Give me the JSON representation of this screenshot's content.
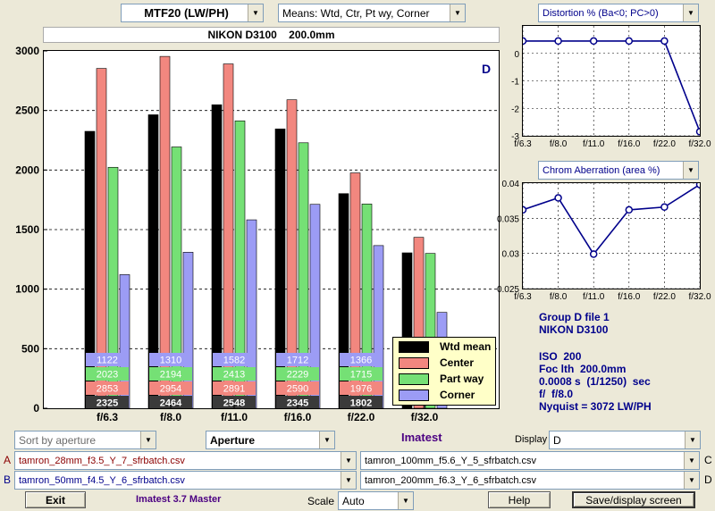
{
  "top": {
    "mtf_select": "MTF20 (LW/PH)",
    "means_select": "Means: Wtd, Ctr, Pt wy, Corner",
    "camera_title": "NIKON D3100    200.0mm"
  },
  "main_chart": {
    "group_label": "D",
    "legend": [
      "Wtd mean",
      "Center",
      "Part way",
      "Corner"
    ],
    "colors": {
      "wtd": "#000000",
      "center": "#f2877f",
      "part": "#75e075",
      "corner": "#9c9cf5"
    }
  },
  "distortion": {
    "select_label": "Distortion %  (Ba<0; PC>0)"
  },
  "chrom": {
    "select_label": "Chrom Aberration (area %)"
  },
  "info": {
    "line1": "Group D file 1",
    "line2": "NIKON D3100",
    "line3": "ISO  200",
    "line4": "Foc lth  200.0mm",
    "line5": "0.0008 s  (1/1250)  sec",
    "line6": "f/  f/8.0",
    "line7": "Nyquist = 3072 LW/PH"
  },
  "controls": {
    "sort_select": "Sort by aperture",
    "aperture_select": "Aperture",
    "imatest_label": "Imatest",
    "display_label": "Display",
    "display_select": "D",
    "file_a_tag": "A",
    "file_a": "tamron_28mm_f3.5_Y_7_sfrbatch.csv",
    "file_b_tag": "B",
    "file_b": "tamron_50mm_f4.5_Y_6_sfrbatch.csv",
    "file_c_tag": "C",
    "file_c": "tamron_100mm_f5.6_Y_5_sfrbatch.csv",
    "file_d_tag": "D",
    "file_d": "tamron_200mm_f6.3_Y_6_sfrbatch.csv",
    "exit_label": "Exit",
    "version_label": "Imatest 3.7 Master",
    "scale_label": "Scale",
    "scale_select": "Auto",
    "help_label": "Help",
    "save_label": "Save/display screen"
  },
  "icons": {
    "dropdown": "chevron-down-icon"
  },
  "chart_data": [
    {
      "type": "bar",
      "title": "",
      "xlabel": "",
      "ylabel": "",
      "categories": [
        "f/6.3",
        "f/8.0",
        "f/11.0",
        "f/16.0",
        "f/22.0",
        "f/32.0"
      ],
      "ylim": [
        0,
        3000
      ],
      "yticks": [
        0,
        500,
        1000,
        1500,
        2000,
        2500,
        3000
      ],
      "grid": true,
      "legend_position": "bottom-right",
      "series": [
        {
          "name": "Wtd mean",
          "values": [
            2325,
            2464,
            2548,
            2345,
            1802,
            1305
          ]
        },
        {
          "name": "Center",
          "values": [
            2853,
            2954,
            2891,
            2590,
            1976,
            1435
          ]
        },
        {
          "name": "Part way",
          "values": [
            2023,
            2194,
            2413,
            2229,
            1715,
            1300
          ]
        },
        {
          "name": "Corner",
          "values": [
            1122,
            1310,
            1582,
            1712,
            1366,
            805
          ]
        }
      ],
      "value_labels": [
        {
          "series": "Wtd mean",
          "values": [
            2325,
            2464,
            2548,
            2345,
            1802
          ]
        },
        {
          "series": "Center",
          "values": [
            2853,
            2954,
            2891,
            2590,
            1976
          ]
        },
        {
          "series": "Part way",
          "values": [
            2023,
            2194,
            2413,
            2229,
            1715
          ]
        },
        {
          "series": "Corner",
          "values": [
            1122,
            1310,
            1582,
            1712,
            1366
          ]
        }
      ]
    },
    {
      "type": "line",
      "title": "Distortion %  (Ba<0; PC>0)",
      "categories": [
        "f/6.3",
        "f/8.0",
        "f/11.0",
        "f/16.0",
        "f/22.0",
        "f/32.0"
      ],
      "ylim": [
        -3,
        1
      ],
      "yticks": [
        0,
        -1,
        -2,
        -3
      ],
      "grid": true,
      "values": [
        0.45,
        0.45,
        0.45,
        0.45,
        0.45,
        -2.85
      ]
    },
    {
      "type": "line",
      "title": "Chrom Aberration (area %)",
      "categories": [
        "f/6.3",
        "f/8.0",
        "f/11.0",
        "f/16.0",
        "f/22.0",
        "f/32.0"
      ],
      "ylim": [
        0.025,
        0.04
      ],
      "yticks": [
        0.04,
        0.035,
        0.03,
        0.025
      ],
      "grid": true,
      "values": [
        0.0362,
        0.0379,
        0.0299,
        0.0362,
        0.0366,
        0.0398
      ]
    }
  ]
}
